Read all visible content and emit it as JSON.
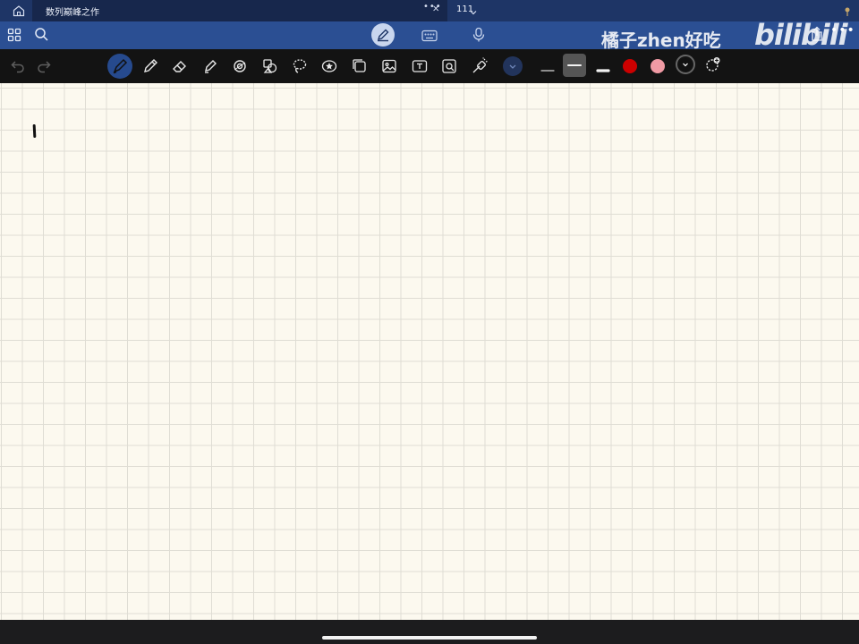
{
  "tabs": {
    "active_title": "数列巅峰之作",
    "more_label": "•••",
    "close_label": "✕",
    "second_title": "111"
  },
  "watermark": {
    "text": "橘子zhen好吃",
    "logo": "bilibili"
  },
  "header": {
    "more_label": "•••"
  },
  "toolbar": {
    "active_tool": "fountain-pen",
    "colors": [
      "#cc0000",
      "#f09aa4",
      "#111111"
    ],
    "selected_color": "#111111",
    "selected_stroke": "medium"
  },
  "canvas": {
    "paper": "grid",
    "paper_color": "#fcf9ef"
  }
}
